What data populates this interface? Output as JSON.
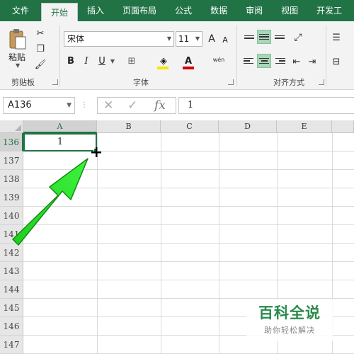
{
  "ribbon_tabs": [
    "文件",
    "开始",
    "插入",
    "页面布局",
    "公式",
    "数据",
    "审阅",
    "视图",
    "开发工"
  ],
  "clipboard": {
    "paste_label": "粘贴",
    "group_label": "剪贴板"
  },
  "font": {
    "name": "宋体",
    "size": "11",
    "grow": "A",
    "shrink": "A",
    "bold": "B",
    "italic": "I",
    "underline": "U",
    "phonetic": "wén",
    "group_label": "字体"
  },
  "alignment": {
    "group_label": "对齐方式"
  },
  "formula_bar": {
    "name_box": "A136",
    "fx": "fx",
    "formula": "1"
  },
  "columns": [
    "A",
    "B",
    "C",
    "D",
    "E"
  ],
  "rows": [
    "136",
    "137",
    "138",
    "139",
    "140",
    "141",
    "142",
    "143",
    "144",
    "145",
    "146",
    "147"
  ],
  "active_cell_value": "1",
  "watermark": {
    "title": "百科全说",
    "subtitle": "助你轻松解决"
  },
  "colors": {
    "accent": "#217346",
    "arrow": "#22dd22",
    "highlight": "#f5e700",
    "font_color": "#d00000"
  }
}
